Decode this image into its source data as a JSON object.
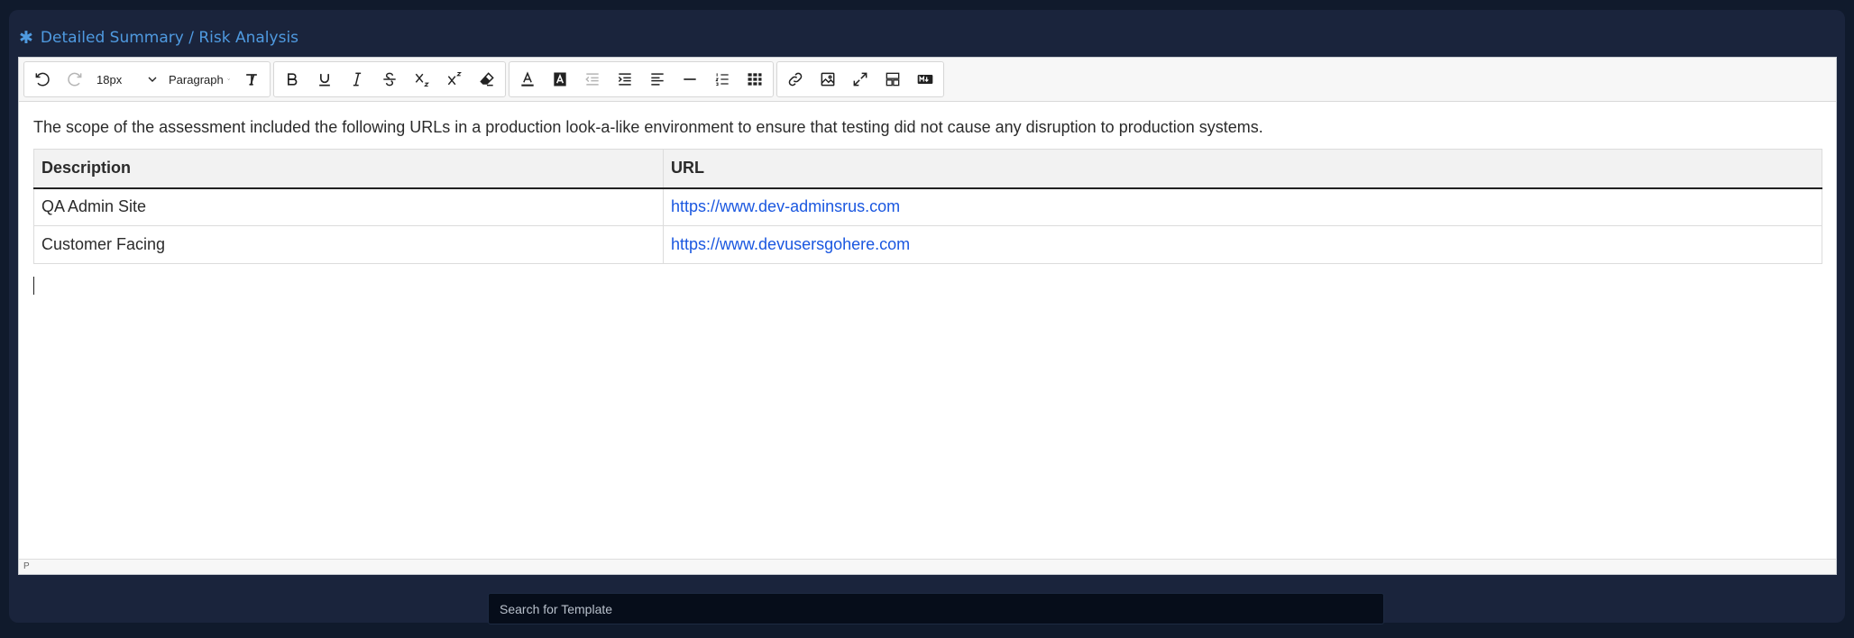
{
  "header": {
    "title": "Detailed Summary / Risk Analysis",
    "icon": "asterisk-icon"
  },
  "toolbar": {
    "font_size": "18px",
    "block_format": "Paragraph"
  },
  "content": {
    "intro": "The scope of the assessment included the following URLs in a production look-a-like environment to ensure that testing did not cause any disruption to production systems.",
    "table": {
      "headers": [
        "Description",
        "URL"
      ],
      "rows": [
        [
          "QA Admin Site",
          "https://www.dev-adminsrus.com"
        ],
        [
          "Customer Facing",
          "https://www.devusersgohere.com"
        ]
      ]
    }
  },
  "status": {
    "path": "P"
  },
  "search": {
    "placeholder": "Search for Template"
  },
  "colors": {
    "accent": "#4f9ae0",
    "link": "#1a57e0",
    "background": "#101a2c",
    "panel": "#1a243c"
  }
}
